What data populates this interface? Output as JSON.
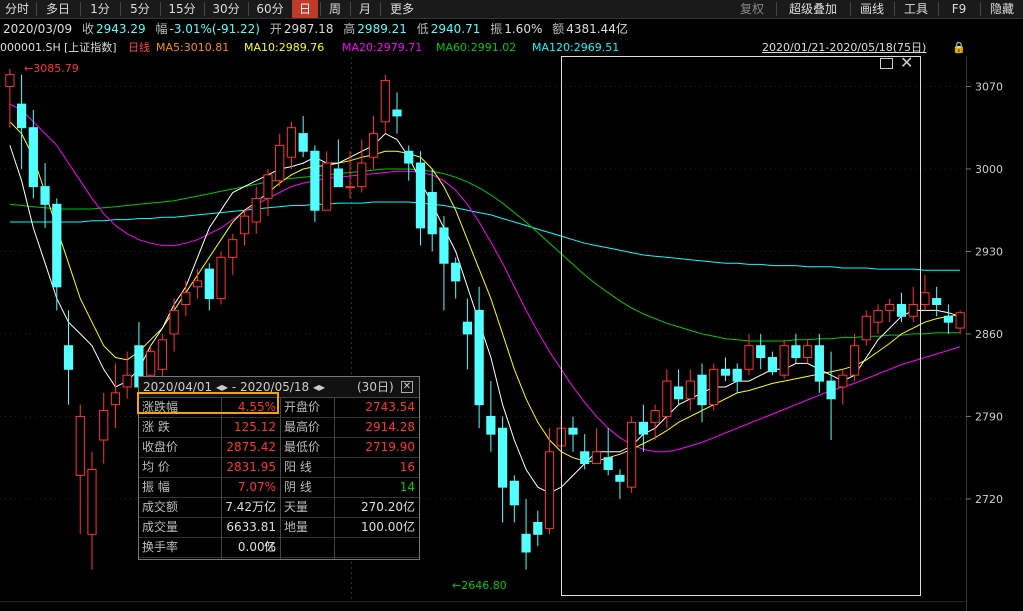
{
  "toolbar": {
    "periods": [
      "分时",
      "多日",
      "1分",
      "5分",
      "15分",
      "30分",
      "60分",
      "日",
      "周",
      "月",
      "更多"
    ],
    "active_period": "日",
    "right_buttons": [
      "复权",
      "超级叠加",
      "画线",
      "工具",
      "F9",
      "隐藏"
    ]
  },
  "info": {
    "date": "2020/03/09",
    "close_label": "收",
    "close": "2943.29",
    "change_label": "幅",
    "change": "-3.01%(-91.22)",
    "open_label": "开",
    "open": "2987.18",
    "high_label": "高",
    "high": "2989.21",
    "low_label": "低",
    "low": "2940.71",
    "amp_label": "振",
    "amp": "1.60%",
    "amount_label": "额",
    "amount": "4381.44亿"
  },
  "ma_bar": {
    "code": "000001.SH",
    "name": "[上证指数]",
    "period": "日线",
    "ma5": "MA5:3010.81",
    "ma10": "MA10:2989.76",
    "ma20": "MA20:2979.71",
    "ma60": "MA60:2991.02",
    "ma120": "MA120:2969.51",
    "range": "2020/01/21-2020/05/18(75日)"
  },
  "selection_box": {
    "range_label": "2020/04/01 ◂▸ - 2020/05/18 ◂▸",
    "count": "(30日)",
    "rows": [
      {
        "l1": "涨跌幅",
        "v1": "4.55%",
        "l2": "开盘价",
        "v2": "2743.54"
      },
      {
        "l1": "涨  跌",
        "v1": "125.12",
        "l2": "最高价",
        "v2": "2914.28"
      },
      {
        "l1": "收盘价",
        "v1": "2875.42",
        "l2": "最低价",
        "v2": "2719.90"
      },
      {
        "l1": "均  价",
        "v1": "2831.95",
        "l2": "阳  线",
        "v2": "16"
      },
      {
        "l1": "振  幅",
        "v1": "7.07%",
        "l2": "阴  线",
        "v2": "14"
      },
      {
        "l1": "成交额",
        "v1": "7.42万亿",
        "l2": "天量",
        "v2": "270.20亿"
      },
      {
        "l1": "成交量",
        "v1": "6633.81亿",
        "l2": "地量",
        "v2": "100.00亿"
      },
      {
        "l1": "换手率",
        "v1": "0.00%",
        "l2": "",
        "v2": ""
      }
    ]
  },
  "colors": {
    "up": "#ff3232",
    "down": "#54ffff",
    "ma5": "#ffffff",
    "ma10": "#ffff00",
    "ma20": "#ff00ff",
    "ma60": "#00c800",
    "ma120": "#00ffff",
    "accent": "#f0a30a"
  },
  "chart_data": {
    "type": "candlestick",
    "title": "上证指数 日线",
    "y_ticks": [
      3070,
      3000,
      2930,
      2860,
      2790,
      2720
    ],
    "ylim": [
      2630,
      3095
    ],
    "max_label": "3085.79",
    "min_label": "2646.80",
    "candles": [
      [
        3070,
        3085,
        3035,
        3080
      ],
      [
        3055,
        3080,
        3000,
        3035
      ],
      [
        3035,
        3050,
        2975,
        2985
      ],
      [
        2985,
        3005,
        2950,
        2970
      ],
      [
        2970,
        2975,
        2880,
        2900
      ],
      [
        2850,
        2880,
        2800,
        2830
      ],
      [
        2740,
        2800,
        2690,
        2790
      ],
      [
        2690,
        2760,
        2660,
        2745
      ],
      [
        2770,
        2810,
        2750,
        2795
      ],
      [
        2800,
        2835,
        2780,
        2810
      ],
      [
        2815,
        2845,
        2805,
        2825
      ],
      [
        2850,
        2870,
        2800,
        2815
      ],
      [
        2825,
        2850,
        2815,
        2845
      ],
      [
        2830,
        2860,
        2820,
        2855
      ],
      [
        2860,
        2890,
        2845,
        2880
      ],
      [
        2885,
        2905,
        2875,
        2895
      ],
      [
        2900,
        2915,
        2890,
        2905
      ],
      [
        2915,
        2920,
        2880,
        2890
      ],
      [
        2890,
        2930,
        2885,
        2925
      ],
      [
        2925,
        2945,
        2910,
        2940
      ],
      [
        2945,
        2965,
        2935,
        2960
      ],
      [
        2955,
        2985,
        2945,
        2975
      ],
      [
        2975,
        3000,
        2960,
        2995
      ],
      [
        2990,
        3030,
        2985,
        3020
      ],
      [
        3010,
        3040,
        3000,
        3035
      ],
      [
        3030,
        3045,
        3010,
        3015
      ],
      [
        3015,
        3020,
        2955,
        2965
      ],
      [
        2965,
        3015,
        2965,
        3005
      ],
      [
        3000,
        3025,
        2990,
        2985
      ],
      [
        2985,
        3015,
        2975,
        2985
      ],
      [
        2985,
        3025,
        2980,
        3005
      ],
      [
        3010,
        3045,
        3000,
        3030
      ],
      [
        3040,
        3080,
        3030,
        3075
      ],
      [
        3050,
        3065,
        3030,
        3045
      ],
      [
        3015,
        3020,
        2990,
        3005
      ],
      [
        3005,
        3015,
        2935,
        2950
      ],
      [
        2980,
        3000,
        2930,
        2945
      ],
      [
        2950,
        2960,
        2880,
        2920
      ],
      [
        2920,
        2925,
        2890,
        2905
      ],
      [
        2870,
        2890,
        2830,
        2860
      ],
      [
        2880,
        2900,
        2780,
        2800
      ],
      [
        2790,
        2820,
        2760,
        2775
      ],
      [
        2780,
        2790,
        2700,
        2730
      ],
      [
        2735,
        2740,
        2700,
        2715
      ],
      [
        2690,
        2720,
        2660,
        2675
      ],
      [
        2700,
        2710,
        2680,
        2690
      ],
      [
        2695,
        2780,
        2690,
        2760
      ],
      [
        2765,
        2790,
        2740,
        2780
      ],
      [
        2780,
        2790,
        2760,
        2775
      ],
      [
        2760,
        2775,
        2745,
        2750
      ],
      [
        2750,
        2780,
        2750,
        2760
      ],
      [
        2755,
        2780,
        2740,
        2745
      ],
      [
        2740,
        2745,
        2720,
        2735
      ],
      [
        2730,
        2790,
        2725,
        2785
      ],
      [
        2785,
        2800,
        2760,
        2775
      ],
      [
        2785,
        2800,
        2770,
        2795
      ],
      [
        2790,
        2830,
        2780,
        2820
      ],
      [
        2815,
        2830,
        2800,
        2805
      ],
      [
        2805,
        2830,
        2795,
        2820
      ],
      [
        2825,
        2835,
        2785,
        2800
      ],
      [
        2800,
        2835,
        2795,
        2830
      ],
      [
        2830,
        2840,
        2820,
        2825
      ],
      [
        2830,
        2835,
        2810,
        2820
      ],
      [
        2830,
        2860,
        2825,
        2850
      ],
      [
        2850,
        2860,
        2830,
        2840
      ],
      [
        2840,
        2845,
        2825,
        2828
      ],
      [
        2825,
        2855,
        2822,
        2850
      ],
      [
        2850,
        2860,
        2835,
        2840
      ],
      [
        2840,
        2855,
        2835,
        2850
      ],
      [
        2850,
        2860,
        2810,
        2820
      ],
      [
        2820,
        2845,
        2770,
        2805
      ],
      [
        2815,
        2830,
        2800,
        2825
      ],
      [
        2825,
        2860,
        2820,
        2850
      ],
      [
        2855,
        2880,
        2850,
        2875
      ],
      [
        2870,
        2885,
        2860,
        2880
      ],
      [
        2880,
        2890,
        2870,
        2885
      ],
      [
        2885,
        2895,
        2870,
        2875
      ],
      [
        2875,
        2900,
        2870,
        2885
      ],
      [
        2885,
        2910,
        2880,
        2895
      ],
      [
        2890,
        2900,
        2875,
        2885
      ],
      [
        2875,
        2885,
        2860,
        2870
      ],
      [
        2865,
        2880,
        2860,
        2878
      ]
    ],
    "ma5": [
      3020,
      2990,
      2950,
      2920,
      2890,
      2870,
      2860,
      2850,
      2830,
      2815,
      2820,
      2830,
      2850,
      2865,
      2885,
      2900,
      2925,
      2950,
      2965,
      2980,
      2985,
      2990,
      2995,
      3000,
      3002,
      3005,
      3010,
      3005,
      3005,
      3010,
      3015,
      3020,
      3030,
      3025,
      3010,
      2990,
      2970,
      2950,
      2930,
      2900,
      2870,
      2840,
      2800,
      2770,
      2745,
      2730,
      2725,
      2730,
      2740,
      2750,
      2760,
      2760,
      2760,
      2765,
      2775,
      2780,
      2790,
      2800,
      2805,
      2810,
      2815,
      2815,
      2820,
      2820,
      2825,
      2830,
      2830,
      2835,
      2835,
      2830,
      2825,
      2820,
      2825,
      2840,
      2855,
      2865,
      2875,
      2880,
      2880,
      2880,
      2878,
      2875
    ],
    "ma10": [
      3040,
      3030,
      3010,
      2980,
      2950,
      2920,
      2890,
      2870,
      2850,
      2840,
      2838,
      2845,
      2855,
      2865,
      2880,
      2895,
      2910,
      2925,
      2940,
      2955,
      2965,
      2972,
      2980,
      2988,
      2995,
      3000,
      3002,
      3003,
      3005,
      3007,
      3010,
      3012,
      3015,
      3015,
      3013,
      3010,
      3000,
      2985,
      2965,
      2940,
      2915,
      2890,
      2860,
      2830,
      2805,
      2785,
      2770,
      2760,
      2755,
      2752,
      2752,
      2755,
      2758,
      2762,
      2767,
      2772,
      2778,
      2785,
      2790,
      2795,
      2800,
      2805,
      2810,
      2812,
      2815,
      2818,
      2820,
      2822,
      2824,
      2826,
      2828,
      2830,
      2833,
      2838,
      2845,
      2852,
      2860,
      2865,
      2870,
      2873,
      2875,
      2876
    ],
    "ma20": [
      3055,
      3050,
      3040,
      3030,
      3020,
      3005,
      2990,
      2975,
      2962,
      2952,
      2945,
      2940,
      2937,
      2935,
      2935,
      2937,
      2940,
      2945,
      2950,
      2957,
      2964,
      2970,
      2975,
      2980,
      2985,
      2988,
      2990,
      2992,
      2993,
      2994,
      2995,
      2996,
      2997,
      2998,
      2998,
      2997,
      2995,
      2990,
      2982,
      2970,
      2955,
      2938,
      2920,
      2900,
      2880,
      2862,
      2845,
      2830,
      2815,
      2802,
      2790,
      2780,
      2772,
      2766,
      2762,
      2760,
      2760,
      2762,
      2765,
      2768,
      2772,
      2776,
      2780,
      2784,
      2788,
      2792,
      2796,
      2800,
      2804,
      2808,
      2812,
      2815,
      2818,
      2822,
      2826,
      2830,
      2834,
      2837,
      2840,
      2843,
      2846,
      2849
    ],
    "ma60": [
      2970,
      2969,
      2968,
      2967,
      2966,
      2966,
      2966,
      2966,
      2967,
      2968,
      2969,
      2970,
      2971,
      2972,
      2973,
      2975,
      2977,
      2979,
      2981,
      2983,
      2985,
      2987,
      2989,
      2991,
      2992,
      2993,
      2994,
      2995,
      2996,
      2997,
      2998,
      2999,
      3000,
      3000,
      3000,
      2999,
      2998,
      2996,
      2993,
      2989,
      2984,
      2978,
      2971,
      2963,
      2955,
      2946,
      2937,
      2928,
      2919,
      2910,
      2902,
      2895,
      2888,
      2882,
      2877,
      2873,
      2869,
      2866,
      2863,
      2860,
      2858,
      2856,
      2855,
      2854,
      2854,
      2854,
      2854,
      2855,
      2855,
      2856,
      2856,
      2857,
      2857,
      2858,
      2858,
      2859,
      2859,
      2860,
      2860,
      2861,
      2861,
      2861
    ],
    "ma120": [
      2955,
      2955,
      2955,
      2955,
      2955,
      2955,
      2955,
      2956,
      2956,
      2957,
      2957,
      2958,
      2958,
      2959,
      2959,
      2960,
      2961,
      2962,
      2963,
      2964,
      2965,
      2966,
      2967,
      2968,
      2969,
      2969,
      2970,
      2970,
      2971,
      2971,
      2971,
      2972,
      2972,
      2972,
      2972,
      2971,
      2970,
      2969,
      2967,
      2965,
      2963,
      2961,
      2958,
      2955,
      2952,
      2949,
      2946,
      2943,
      2940,
      2937,
      2935,
      2933,
      2931,
      2929,
      2927,
      2926,
      2925,
      2924,
      2923,
      2922,
      2921,
      2920,
      2920,
      2919,
      2919,
      2918,
      2918,
      2918,
      2917,
      2917,
      2917,
      2916,
      2916,
      2916,
      2915,
      2915,
      2915,
      2915,
      2914,
      2914,
      2914,
      2914
    ]
  }
}
